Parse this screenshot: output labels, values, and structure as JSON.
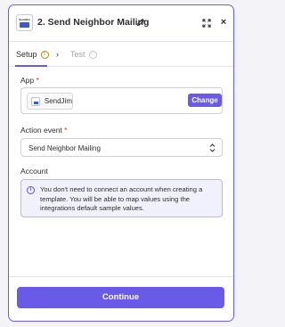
{
  "header": {
    "logo_text_top": "SendJim",
    "title": "2. Send Neighbor Mailing",
    "icons": {
      "edit": "pencil-icon",
      "expand": "expand-icon",
      "close": "close-icon"
    },
    "close_glyph": "×"
  },
  "tabs": [
    {
      "label": "Setup",
      "status_icon": "warning-icon",
      "status_glyph": "!",
      "active": true
    },
    {
      "label": "Test",
      "status_icon": "check-circle-icon",
      "status_glyph": "✓",
      "active": false
    }
  ],
  "tab_separator": "›",
  "app_field": {
    "label": "App",
    "required_mark": "*",
    "app_name": "SendJim",
    "change_label": "Change"
  },
  "action_event": {
    "label": "Action event",
    "required_mark": "*",
    "value": "Send Neighbor Mailing"
  },
  "account": {
    "label": "Account",
    "info_glyph": "i",
    "info_text": "You don't need to connect an account when creating a template. You will be able to map values using the integrations default sample values."
  },
  "footer": {
    "continue_label": "Continue"
  },
  "colors": {
    "accent": "#695be8",
    "info_bg": "#f1f0fd",
    "required": "#d12b2b",
    "warning": "#b8860b"
  }
}
